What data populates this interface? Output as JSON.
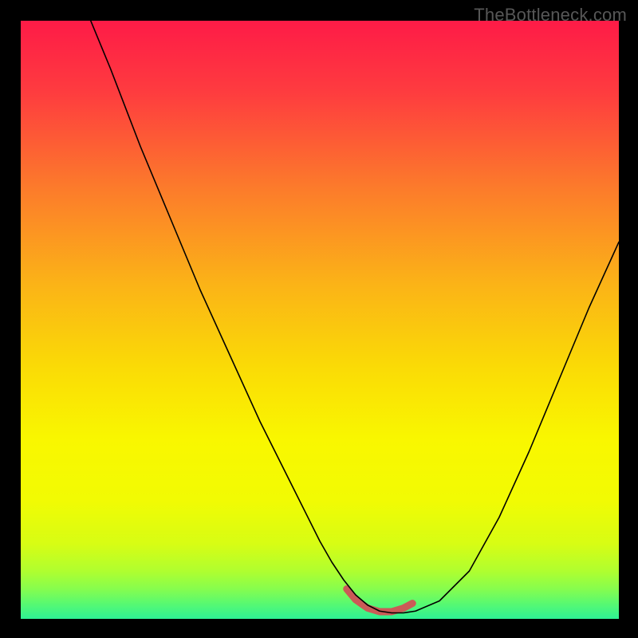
{
  "watermark": "TheBottleneck.com",
  "chart_data": {
    "type": "line",
    "title": "",
    "xlabel": "",
    "ylabel": "",
    "xlim": [
      0,
      100
    ],
    "ylim": [
      0,
      100
    ],
    "grid": false,
    "legend": false,
    "series": [
      {
        "name": "bottleneck-curve",
        "color": "#000000",
        "stroke_width": 1.6,
        "x": [
          11.7,
          15,
          20,
          25,
          30,
          35,
          40,
          45,
          50,
          52,
          54,
          56,
          58,
          60,
          62,
          64,
          66,
          70,
          75,
          80,
          85,
          90,
          95,
          100
        ],
        "y": [
          100,
          92,
          79,
          67,
          55,
          44,
          33,
          23,
          13,
          9.5,
          6.5,
          4,
          2.3,
          1.3,
          1.0,
          1.0,
          1.3,
          3,
          8,
          17,
          28,
          40,
          52,
          63
        ]
      },
      {
        "name": "trough-highlight",
        "color": "#CB5A57",
        "stroke_width": 9,
        "linecap": "round",
        "x": [
          54.5,
          56,
          58,
          60,
          62,
          64,
          65.5
        ],
        "y": [
          5.0,
          3.2,
          1.8,
          1.2,
          1.2,
          1.8,
          2.6
        ]
      }
    ],
    "background_gradient": {
      "direction": "vertical",
      "stops": [
        {
          "offset": 0.0,
          "color": "#FE1B47"
        },
        {
          "offset": 0.12,
          "color": "#FE3C3F"
        },
        {
          "offset": 0.28,
          "color": "#FC7B2B"
        },
        {
          "offset": 0.44,
          "color": "#FBB317"
        },
        {
          "offset": 0.58,
          "color": "#FADB06"
        },
        {
          "offset": 0.7,
          "color": "#F9F700"
        },
        {
          "offset": 0.8,
          "color": "#F2FB03"
        },
        {
          "offset": 0.875,
          "color": "#D7FD14"
        },
        {
          "offset": 0.92,
          "color": "#B0FE2F"
        },
        {
          "offset": 0.95,
          "color": "#86FD4E"
        },
        {
          "offset": 0.975,
          "color": "#57F972"
        },
        {
          "offset": 1.0,
          "color": "#2EF194"
        }
      ]
    }
  }
}
